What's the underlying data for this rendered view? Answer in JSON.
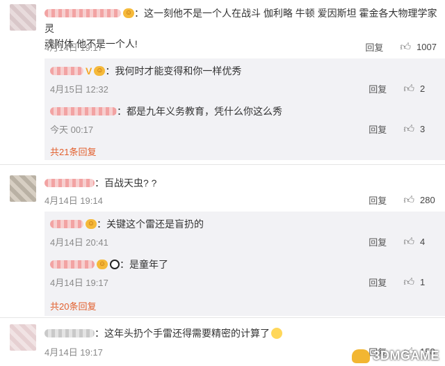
{
  "comments": [
    {
      "text": "这一刻他不是一个人在战斗 伽利略 牛顿 爱因斯坦 霍金各大物理学家灵魂附体 他不是一个人!",
      "text_line1": "这一刻他不是一个人在战斗 伽利略 牛顿 爱因斯坦 霍金各大物理学家灵",
      "text_line2": "魂附体 他不是一个人!",
      "time": "4月14日 19:17",
      "reply_label": "回复",
      "likes": "1007",
      "replies": [
        {
          "text": "我何时才能变得和你一样优秀",
          "time": "4月15日 12:32",
          "reply_label": "回复",
          "likes": "2"
        },
        {
          "text": "都是九年义务教育，凭什么你这么秀",
          "time": "今天 00:17",
          "reply_label": "回复",
          "likes": "3"
        }
      ],
      "more": "共21条回复"
    },
    {
      "text": "百战天虫? ?",
      "time": "4月14日 19:14",
      "reply_label": "回复",
      "likes": "280",
      "replies": [
        {
          "text": "关键这个雷还是盲扔的",
          "time": "4月14日 20:41",
          "reply_label": "回复",
          "likes": "4"
        },
        {
          "text": "是童年了",
          "time": "4月14日 19:17",
          "reply_label": "回复",
          "likes": "1"
        }
      ],
      "more": "共20条回复"
    },
    {
      "text": "这年头扔个手雷还得需要精密的计算了",
      "time": "4月14日 19:17",
      "reply_label": "回复",
      "likes": "158"
    }
  ],
  "icons": {
    "like": "thumbs-up-icon",
    "badge": "vip-badge-icon"
  },
  "colors": {
    "more_link": "#e25f2d",
    "reply_bg": "#f2f2f5"
  },
  "watermark": "3DMGAME"
}
